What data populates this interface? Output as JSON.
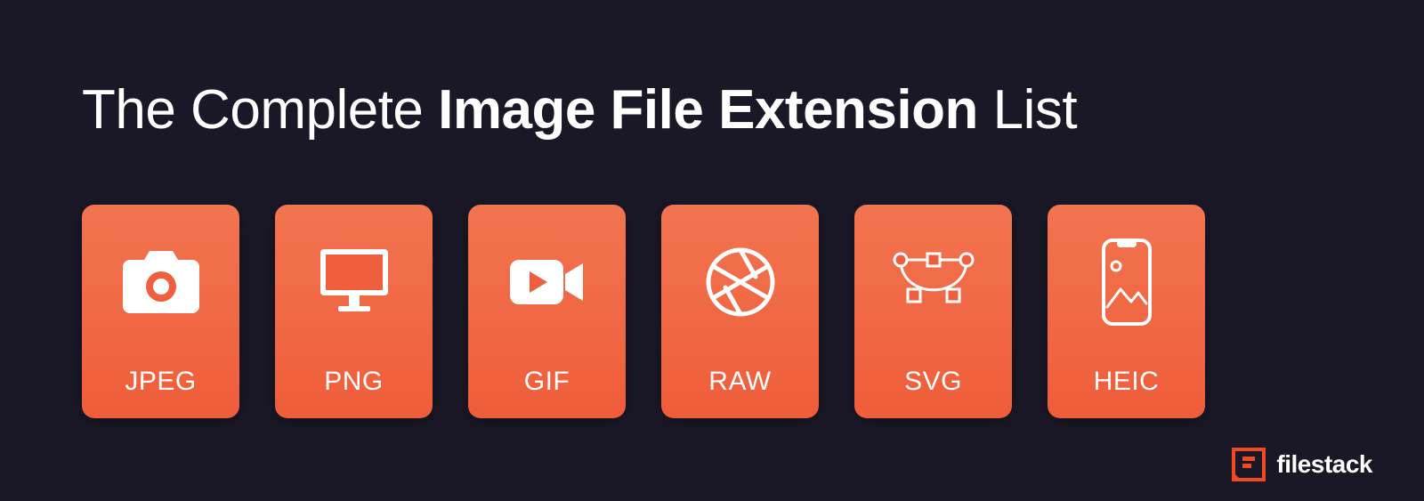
{
  "title": {
    "prefix": "The Complete ",
    "bold": "Image File Extension",
    "suffix": " List"
  },
  "cards": [
    {
      "label": "JPEG",
      "icon": "camera-icon"
    },
    {
      "label": "PNG",
      "icon": "monitor-icon"
    },
    {
      "label": "GIF",
      "icon": "video-icon"
    },
    {
      "label": "RAW",
      "icon": "aperture-icon"
    },
    {
      "label": "SVG",
      "icon": "bezier-icon"
    },
    {
      "label": "HEIC",
      "icon": "phone-image-icon"
    }
  ],
  "brand": {
    "name": "filestack"
  },
  "colors": {
    "background": "#1a1826",
    "card_top": "#f27450",
    "card_bottom": "#ef5d3a",
    "accent": "#ef4a23",
    "text": "#ffffff"
  }
}
